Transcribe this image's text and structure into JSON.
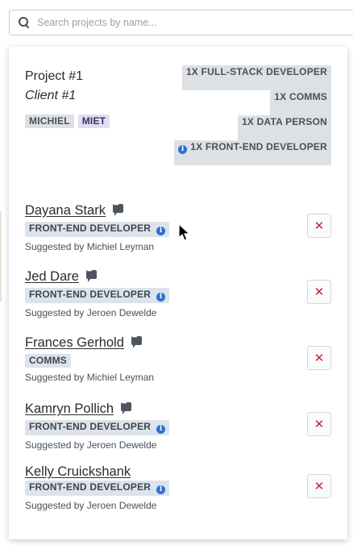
{
  "search": {
    "placeholder": "Search projects by name..."
  },
  "project": {
    "title": "Project #1",
    "client": "Client #1",
    "users": [
      "MICHIEL",
      "MIET"
    ],
    "roles": [
      {
        "label": "1X FULL-STACK DEVELOPER",
        "info": false
      },
      {
        "label": "1X COMMS",
        "info": false
      },
      {
        "label": "1X DATA PERSON",
        "info": false
      },
      {
        "label": "1X FRONT-END DEVELOPER",
        "info": true
      }
    ]
  },
  "candidates": [
    {
      "name": "Dayana Stark",
      "role": "FRONT-END DEVELOPER",
      "info": true,
      "suggested_by": "Suggested by Michiel Leyman"
    },
    {
      "name": "Jed Dare",
      "role": "FRONT-END DEVELOPER",
      "info": true,
      "suggested_by": "Suggested by Jeroen Dewelde"
    },
    {
      "name": "Frances Gerhold",
      "role": "COMMS",
      "info": false,
      "suggested_by": "Suggested by Michiel Leyman"
    },
    {
      "name": "Kamryn Pollich",
      "role": "FRONT-END DEVELOPER",
      "info": true,
      "suggested_by": "Suggested by Jeroen Dewelde"
    },
    {
      "name": "Kelly Cruickshank",
      "role": "FRONT-END DEVELOPER",
      "info": true,
      "suggested_by": "Suggested by Jeroen Dewelde"
    }
  ],
  "icons": {
    "search": "search-icon",
    "info": "info-icon",
    "chat": "chat-icon",
    "remove": "close-icon",
    "cursor": "mouse-cursor-icon"
  },
  "colors": {
    "remove": "#c9262b",
    "info": "#2e6fd1",
    "user_tag_purple": "#e2ddf2"
  }
}
